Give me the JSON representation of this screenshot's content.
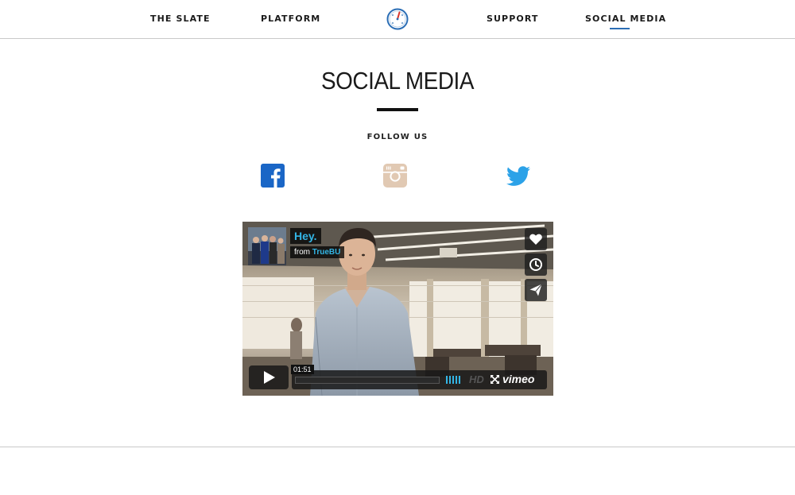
{
  "nav": {
    "items": [
      {
        "label": "THE SLATE"
      },
      {
        "label": "PLATFORM"
      },
      {
        "label": "SUPPORT"
      },
      {
        "label": "SOCIAL MEDIA",
        "active": true
      }
    ],
    "logo_icon": "compass-gauge-icon",
    "accent_color": "#2a6db5"
  },
  "section": {
    "title": "SOCIAL MEDIA",
    "subtitle": "FOLLOW US"
  },
  "social": {
    "icons": [
      "facebook-icon",
      "instagram-icon",
      "twitter-icon"
    ],
    "colors": {
      "facebook": "#1a66c6",
      "instagram": "#e1c9b3",
      "twitter": "#2ca2e8"
    }
  },
  "video": {
    "title": "Hey.",
    "from_prefix": "from",
    "from_user": "TrueBU",
    "time": "01:51",
    "hd_label": "HD",
    "brand": "vimeo",
    "actions": [
      "like-icon",
      "watch-later-icon",
      "share-icon"
    ]
  }
}
